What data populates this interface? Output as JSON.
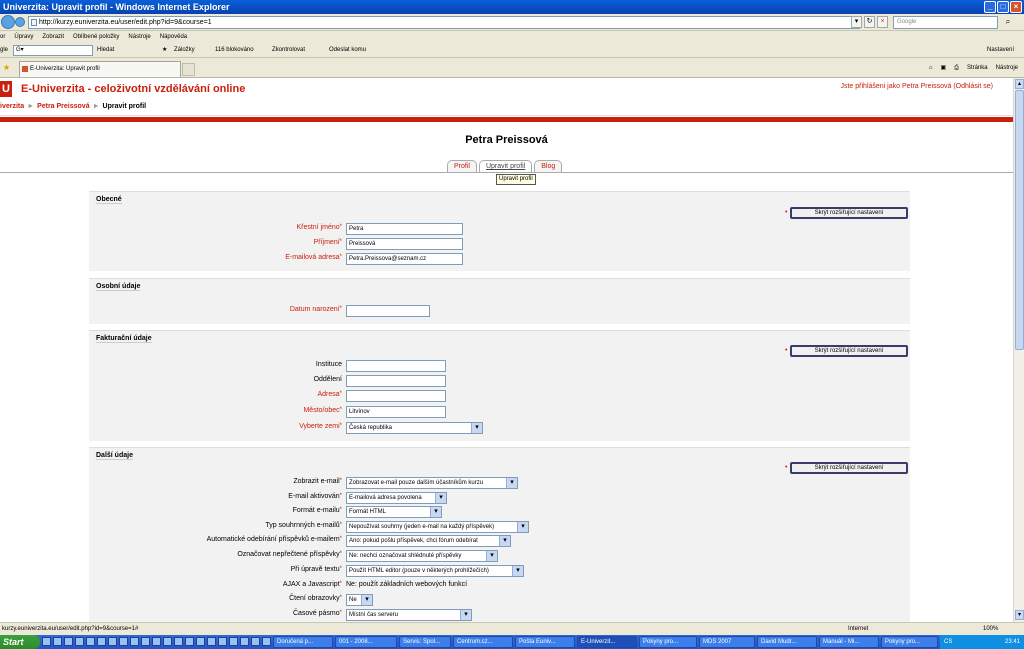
{
  "window": {
    "title": "Univerzita: Upravit profil - Windows Internet Explorer"
  },
  "addressbar": {
    "url": "http://kurzy.euniverzita.eu/user/edit.php?id=9&course=1",
    "search_placeholder": "Google"
  },
  "menu": [
    "or",
    "Úpravy",
    "Zobrazit",
    "Oblíbené položky",
    "Nástroje",
    "Nápověda"
  ],
  "toolbar": {
    "search_label": "Hledat",
    "bookmarks": "Záložky",
    "blocked": "116 blokováno",
    "check": "Zkontrolovat",
    "send": "Odeslat komu",
    "settings": "Nastavení"
  },
  "browser_tab": {
    "label": "E-Univerzita: Upravit profil"
  },
  "tab_tools": {
    "page": "Stránka",
    "tools": "Nástroje"
  },
  "site": {
    "logo": "U",
    "title": "E-Univerzita - celoživotní vzdělávání online",
    "login_info": "Jste přihlášeni jako Petra Preissová (Odhlásit se)",
    "breadcrumbs": [
      "iverzita",
      "Petra Preissová",
      "Upravit profil"
    ]
  },
  "profile": {
    "title": "Petra Preissová",
    "tabs": [
      "Profil",
      "Upravit profil",
      "Blog"
    ],
    "tooltip": "Upravit profil",
    "advanced_button": "Skrýt rozšiřující nastavení"
  },
  "sections": {
    "general": {
      "legend": "Obecné",
      "fields": [
        {
          "label": "Křestní jméno",
          "value": "Petra",
          "required": true
        },
        {
          "label": "Příjmení",
          "value": "Preissová",
          "required": true
        },
        {
          "label": "E-mailová adresa",
          "value": "Petra.Preissova@seznam.cz",
          "required": true
        }
      ]
    },
    "personal": {
      "legend": "Osobní údaje",
      "fields": [
        {
          "label": "Datum narození",
          "value": "",
          "required": true
        }
      ]
    },
    "billing": {
      "legend": "Fakturační údaje",
      "fields": [
        {
          "label": "Instituce",
          "value": "",
          "required": false
        },
        {
          "label": "Oddělení",
          "value": "",
          "required": false
        },
        {
          "label": "Adresa",
          "value": "",
          "required": true
        },
        {
          "label": "Město/obec",
          "value": "Litvínov",
          "required": true
        },
        {
          "label": "Vyberte zemi",
          "value": "Česká republika",
          "required": true
        }
      ]
    },
    "other": {
      "legend": "Další údaje",
      "fields": [
        {
          "label": "Zobrazit e-mail",
          "value": "Zobrazovat e-mail pouze dalším účastníkům kurzu",
          "required": true
        },
        {
          "label": "E-mail aktivován",
          "value": "E-mailová adresa povolena",
          "required": true
        },
        {
          "label": "Formát e-mailu",
          "value": "Formát HTML",
          "required": true
        },
        {
          "label": "Typ souhrnných e-mailů",
          "value": "Nepoužívat souhrny (jeden e-mail na každý příspěvek)",
          "required": true
        },
        {
          "label": "Automatické odebírání příspěvků e-mailem",
          "value": "Ano: pokud pošlu příspěvek, chci fórum odebírat",
          "required": true
        },
        {
          "label": "Označovat nepřečtené příspěvky",
          "value": "Ne: nechci označovat shlédnuté příspěvky",
          "required": true
        },
        {
          "label": "Při úpravě textu",
          "value": "Použít HTML editor (pouze v některých prohlížečích)",
          "required": true
        },
        {
          "label": "AJAX a Javascript",
          "value": "Ne: použít základních webových funkcí",
          "required": true
        },
        {
          "label": "Čtení obrazovky",
          "value": "Ne",
          "required": true
        },
        {
          "label": "Časové pásmo",
          "value": "Místní čas serveru",
          "required": true
        }
      ]
    }
  },
  "statusbar": {
    "url": "kurzy.euniverzita.eu/user/edit.php?id=9&course=1#",
    "zone": "Internet",
    "zoom": "100%"
  },
  "taskbar": {
    "start": "Start",
    "tasks": [
      "Doručená p...",
      "001 - 2008...",
      "Servis: Spol...",
      "Centrum.cz...",
      "Pošta Euniv...",
      "E-Univerzit...",
      "Pokyny pro...",
      "MDS 2007",
      "David Mudr...",
      "Manuál - Mi...",
      "Pokyny pro..."
    ],
    "lang": "CS",
    "clock": "23:41"
  }
}
